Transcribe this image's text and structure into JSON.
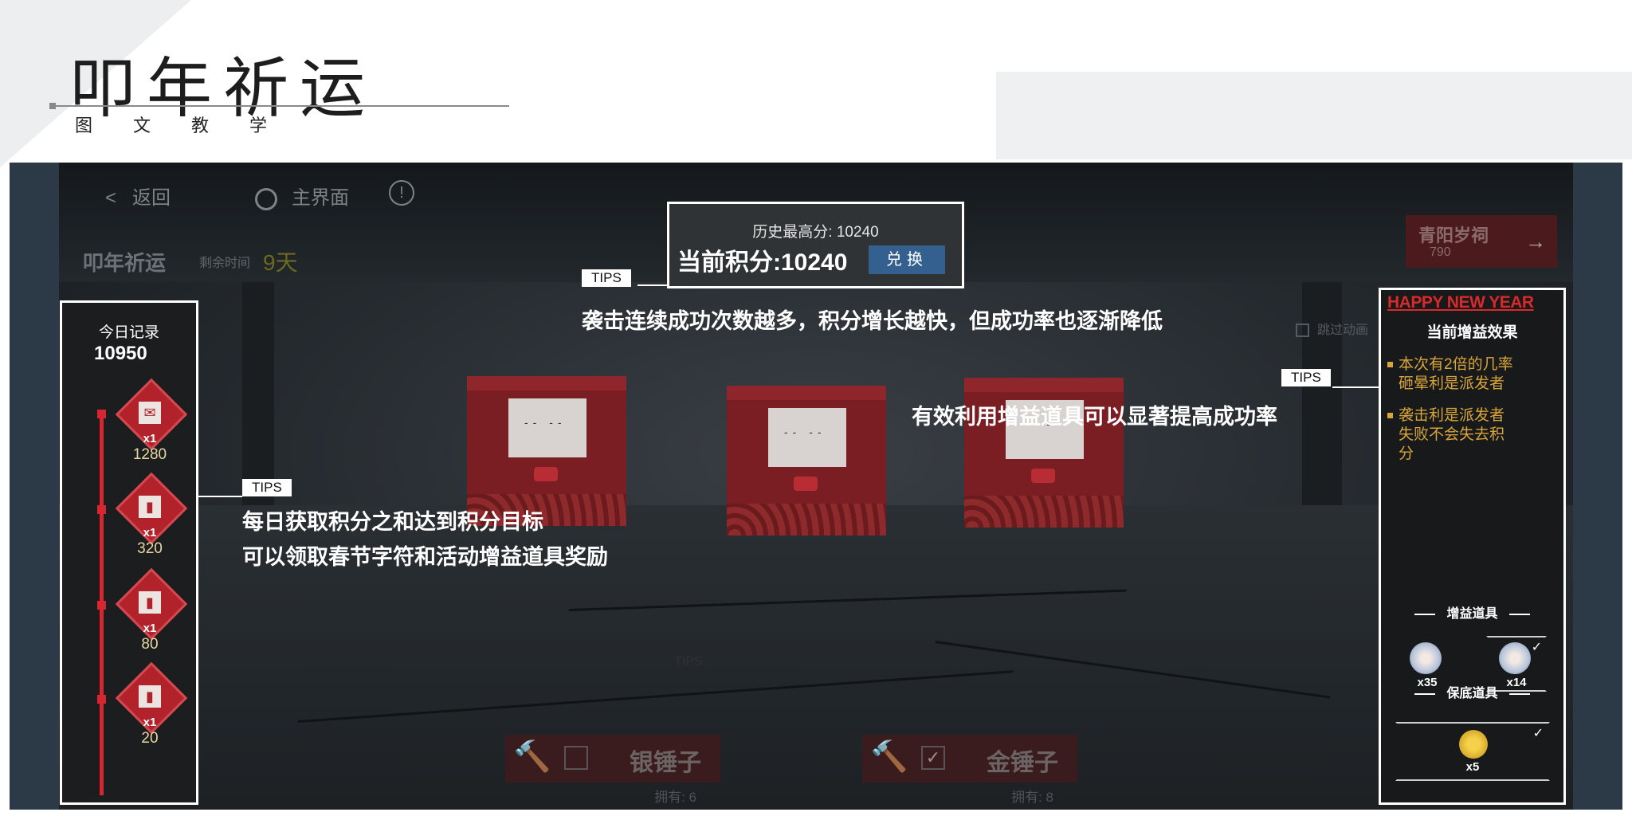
{
  "header": {
    "title": "叩年祈运",
    "subtitle": "图 文 教 学"
  },
  "game": {
    "nav": {
      "back": "返回",
      "home": "主界面",
      "info": "!"
    },
    "event_name": "叩年祈运",
    "remaining_label": "剩余时间",
    "remaining_value": "9天",
    "banner": {
      "title": "青阳岁祠",
      "count": "790",
      "arrow": "→"
    },
    "skip_label": "跳过动画",
    "hammers": [
      {
        "label": "银锤子",
        "owned": "拥有: 6",
        "checked": ""
      },
      {
        "label": "金锤子",
        "owned": "拥有: 8",
        "checked": "✓"
      }
    ],
    "ghost_tips": "TIPS"
  },
  "score": {
    "history_high": "历史最高分: 10240",
    "current": "当前积分:10240",
    "exchange": "兑换"
  },
  "daily": {
    "title": "今日记录",
    "total": "10950",
    "rewards": [
      {
        "count": "x1",
        "points": "1280",
        "icon": "red-envelope-icon"
      },
      {
        "count": "x1",
        "points": "320",
        "icon": "red-book-icon"
      },
      {
        "count": "x1",
        "points": "80",
        "icon": "red-book-icon"
      },
      {
        "count": "x1",
        "points": "20",
        "icon": "red-book-icon"
      }
    ]
  },
  "buff_panel": {
    "banner": "HAPPY NEW YEAR",
    "title": "当前增益效果",
    "effects": [
      {
        "line1": "本次有2倍的几率",
        "line2": "砸晕利是派发者"
      },
      {
        "line1": "袭击利是派发者",
        "line2": "失败不会失去积",
        "line3": "分"
      }
    ],
    "items_section": "增益道具",
    "items": [
      {
        "qty": "x35",
        "selected": false
      },
      {
        "qty": "x14",
        "selected": true
      }
    ],
    "guarantee_section": "保底道具",
    "guarantee": {
      "qty": "x5",
      "selected": true
    }
  },
  "tips": {
    "tag": "TIPS",
    "top": "袭击连续成功次数越多，积分增长越快，但成功率也逐渐降低",
    "right": "有效利用增益道具可以显著提高成功率",
    "left_line1": "每日获取积分之和达到积分目标",
    "left_line2": "可以领取春节字符和活动增益道具奖励"
  },
  "colors": {
    "accent_red": "#d6262f",
    "gold_text": "#d9a53a",
    "exchange_blue": "#33608e"
  }
}
